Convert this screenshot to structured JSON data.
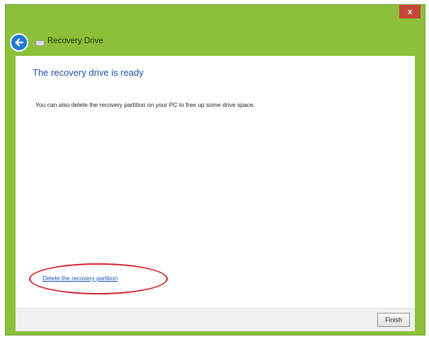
{
  "window": {
    "title": "Recovery Drive",
    "close_label": "x",
    "accent_color": "#8dc03a"
  },
  "icons": {
    "back": "back-arrow-icon",
    "drive": "drive-icon"
  },
  "content": {
    "heading": "The recovery drive is ready",
    "description": "You can also delete the recovery partition on your PC to free up some drive space.",
    "delete_link": "Delete the recovery partition"
  },
  "footer": {
    "finish_label": "Finish"
  },
  "annotation": {
    "highlight_color": "#d4212a"
  }
}
